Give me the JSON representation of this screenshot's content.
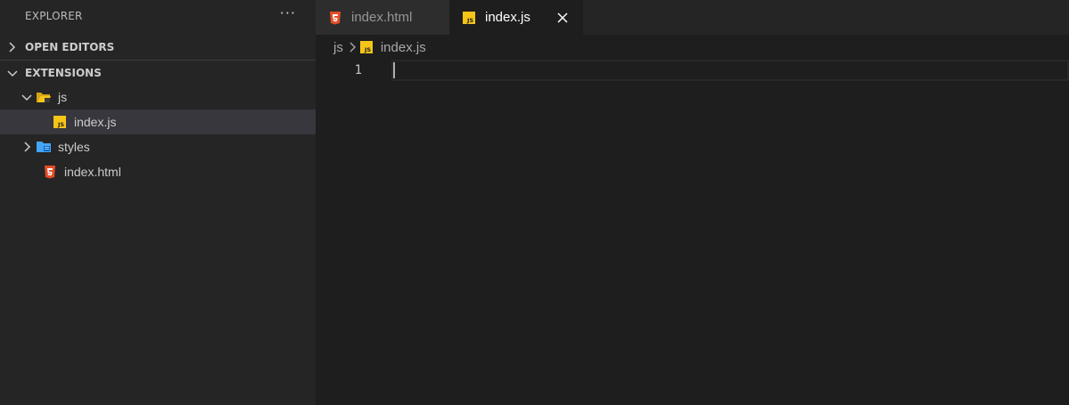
{
  "sidebar": {
    "title": "EXPLORER",
    "more_label": "···",
    "sections": {
      "open_editors": "OPEN EDITORS",
      "extensions": "EXTENSIONS"
    },
    "tree": [
      {
        "label": "js",
        "icon": "folder-js-open-icon",
        "expanded": true
      },
      {
        "label": "index.js",
        "icon": "js-file-icon",
        "selected": true
      },
      {
        "label": "styles",
        "icon": "folder-styles-icon",
        "expanded": false
      },
      {
        "label": "index.html",
        "icon": "html-file-icon"
      }
    ]
  },
  "tabs": [
    {
      "label": "index.html",
      "icon": "html-file-icon",
      "active": false
    },
    {
      "label": "index.js",
      "icon": "js-file-icon",
      "active": true
    }
  ],
  "breadcrumb": {
    "folder": "js",
    "file": "index.js"
  },
  "editor": {
    "line_numbers": [
      "1"
    ]
  },
  "colors": {
    "html_icon": "#e44d26",
    "js_icon": "#f5c518",
    "folder_js": "#f5c518",
    "folder_styles": "#42a5f5",
    "sidebar_bg": "#252526",
    "editor_bg": "#1e1e1e",
    "selected_row": "#37373d"
  }
}
